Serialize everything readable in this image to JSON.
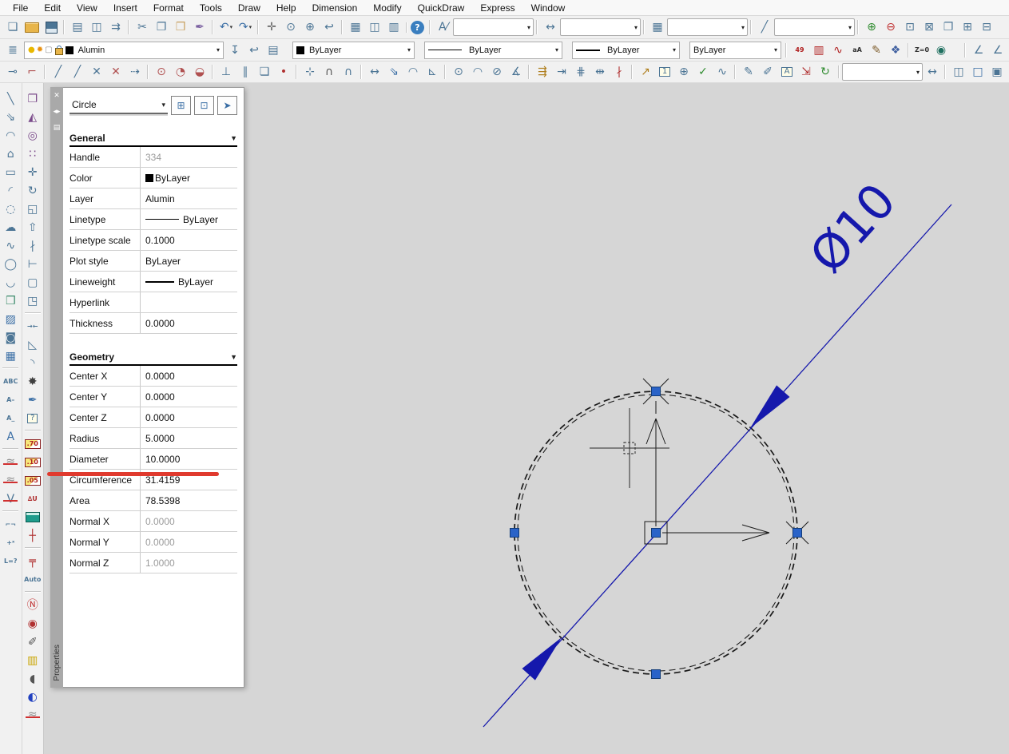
{
  "menu": {
    "items": [
      "File",
      "Edit",
      "View",
      "Insert",
      "Format",
      "Tools",
      "Draw",
      "Help",
      "Dimension",
      "Modify",
      "QuickDraw",
      "Express",
      "Window"
    ]
  },
  "toolbars": {
    "row1": [
      {
        "name": "new-file",
        "glyph": "❏",
        "color": "#4C7595"
      },
      {
        "name": "open-folder",
        "cls": "i-folder"
      },
      {
        "name": "save",
        "cls": "i-floppy"
      },
      {
        "name": "print",
        "glyph": "▤",
        "sep": true
      },
      {
        "name": "print-preview",
        "glyph": "◫"
      },
      {
        "name": "publish",
        "glyph": "⇉"
      },
      {
        "name": "cut",
        "glyph": "✂",
        "sep": true
      },
      {
        "name": "copy-clip",
        "glyph": "❐"
      },
      {
        "name": "paste",
        "glyph": "❒",
        "color": "#C8A060"
      },
      {
        "name": "format-painter",
        "glyph": "✒",
        "color": "#7A5FA0"
      },
      {
        "name": "undo",
        "glyph": "↶",
        "color": "#3A6EA5",
        "dd": true,
        "sep": true
      },
      {
        "name": "redo",
        "glyph": "↷",
        "color": "#3A6EA5",
        "dd": true
      },
      {
        "name": "pan",
        "glyph": "✛",
        "color": "#666666",
        "sep": true
      },
      {
        "name": "zoom-realtime",
        "glyph": "⊙"
      },
      {
        "name": "zoom-window-rt",
        "glyph": "⊕"
      },
      {
        "name": "zoom-previous",
        "glyph": "↩"
      },
      {
        "name": "properties-palette",
        "glyph": "▦",
        "sep": true
      },
      {
        "name": "designcenter",
        "glyph": "◫"
      },
      {
        "name": "tool-palettes",
        "glyph": "▥"
      },
      {
        "name": "help",
        "cls": "i-help",
        "glyph": "?",
        "sep": true
      },
      {
        "name": "text-style",
        "glyph": "A⁄",
        "sep": true
      },
      {
        "name": "text-style-dropdown",
        "cls": "dd"
      },
      {
        "name": "dim-style-icon",
        "glyph": "↔",
        "sep": true
      },
      {
        "name": "dim-style-dropdown",
        "cls": "dd"
      },
      {
        "name": "table-style-icon",
        "glyph": "▦",
        "sep": true
      },
      {
        "name": "table-style-dropdown",
        "cls": "dd"
      },
      {
        "name": "mleader-style-icon",
        "glyph": "╱",
        "sep": true
      },
      {
        "name": "mleader-style-dropdown",
        "cls": "dd"
      },
      {
        "name": "zoom-in",
        "glyph": "⊕",
        "color": "#2E8B2E",
        "sep": true
      },
      {
        "name": "zoom-out",
        "glyph": "⊖",
        "color": "#C03030"
      },
      {
        "name": "zoom-window",
        "glyph": "⊡"
      },
      {
        "name": "zoom-extents",
        "glyph": "⊠"
      },
      {
        "name": "zoom-page",
        "glyph": "❐"
      },
      {
        "name": "zoom-object",
        "glyph": "⊞"
      },
      {
        "name": "zoom-all",
        "glyph": "⊟"
      }
    ],
    "layer_combo": {
      "layer_name": "Alumin"
    },
    "row2_layer_tools": [
      {
        "name": "make-object-layer-current",
        "glyph": "↧"
      },
      {
        "name": "layer-previous",
        "glyph": "↩"
      },
      {
        "name": "layer-states",
        "glyph": "▤"
      }
    ],
    "color_combo": {
      "value": "ByLayer"
    },
    "linetype_combo": {
      "value": "ByLayer"
    },
    "lineweight_combo": {
      "value": "ByLayer"
    },
    "plotstyle_combo": {
      "value": "ByLayer"
    },
    "row2_express": [
      {
        "name": "dim-express-49",
        "glyph": "49",
        "cls": "txt",
        "color": "#B02020",
        "sep": true
      },
      {
        "name": "express-bars",
        "glyph": "▥",
        "color": "#B02020"
      },
      {
        "name": "express-curve",
        "glyph": "∿",
        "color": "#B02020"
      },
      {
        "name": "text-case",
        "glyph": "aA",
        "cls": "txt",
        "color": "#303030"
      },
      {
        "name": "express-edit",
        "glyph": "✎",
        "color": "#806030"
      },
      {
        "name": "express-palette",
        "glyph": "❖",
        "color": "#4060A0"
      },
      {
        "name": "z-zero",
        "glyph": "Z=0",
        "cls": "txt",
        "color": "#303030",
        "sep": true
      },
      {
        "name": "globe",
        "glyph": "◉",
        "color": "#207060"
      }
    ],
    "row2_right": [
      {
        "name": "ucs-angle-1",
        "glyph": "∠",
        "sep": true
      },
      {
        "name": "ucs-angle-2",
        "glyph": "∠"
      }
    ],
    "row3": [
      {
        "name": "snap-from",
        "glyph": "⊸"
      },
      {
        "name": "snap-endpoint",
        "glyph": "⌐",
        "color": "#B05050"
      },
      {
        "name": "line-tool",
        "glyph": "╱",
        "sep": true
      },
      {
        "name": "ray-tool",
        "glyph": "╱"
      },
      {
        "name": "snap-intersection",
        "glyph": "✕"
      },
      {
        "name": "snap-apparent-intersection",
        "glyph": "✕",
        "color": "#B05050"
      },
      {
        "name": "snap-extension",
        "glyph": "⇢"
      },
      {
        "name": "snap-center",
        "glyph": "⊙",
        "color": "#B05050",
        "sep": true
      },
      {
        "name": "snap-quadrant",
        "glyph": "◔",
        "color": "#B05050"
      },
      {
        "name": "snap-tangent",
        "glyph": "◒",
        "color": "#B05050"
      },
      {
        "name": "snap-perpendicular",
        "glyph": "⊥",
        "sep": true
      },
      {
        "name": "snap-parallel",
        "glyph": "∥"
      },
      {
        "name": "snap-insertion",
        "glyph": "❏"
      },
      {
        "name": "snap-node",
        "glyph": "•",
        "color": "#B03030"
      },
      {
        "name": "snap-nearest",
        "glyph": "⊹",
        "sep": true
      },
      {
        "name": "snap-none",
        "glyph": "∩",
        "color": "#555555"
      },
      {
        "name": "osnap-settings",
        "glyph": "∩"
      },
      {
        "name": "dim-linear",
        "glyph": "↔",
        "sep": true
      },
      {
        "name": "dim-aligned",
        "glyph": "⇘",
        "color": "#3A6EA5"
      },
      {
        "name": "dim-arc-length",
        "glyph": "◠"
      },
      {
        "name": "dim-ordinate",
        "glyph": "⊾"
      },
      {
        "name": "dim-radius",
        "glyph": "⊙",
        "sep": true
      },
      {
        "name": "dim-jogged",
        "glyph": "◠"
      },
      {
        "name": "dim-diameter",
        "glyph": "⊘"
      },
      {
        "name": "dim-angular",
        "glyph": "∡"
      },
      {
        "name": "quick-dimension",
        "glyph": "⇶",
        "color": "#B08020",
        "sep": true
      },
      {
        "name": "dim-continue",
        "glyph": "⇥"
      },
      {
        "name": "dim-baseline",
        "glyph": "⋕"
      },
      {
        "name": "dim-spacing",
        "glyph": "⇹"
      },
      {
        "name": "dim-break",
        "glyph": "∤",
        "color": "#B03030"
      },
      {
        "name": "multileader",
        "glyph": "↗",
        "color": "#B08020",
        "sep": true
      },
      {
        "name": "tolerance",
        "glyph": "1",
        "cls": "boxed"
      },
      {
        "name": "center-mark",
        "glyph": "⊕"
      },
      {
        "name": "dim-inspect",
        "glyph": "✓",
        "color": "#2E8B2E"
      },
      {
        "name": "dim-jog-line",
        "glyph": "∿"
      },
      {
        "name": "dim-edit",
        "glyph": "✎",
        "sep": true
      },
      {
        "name": "dim-text-edit",
        "glyph": "✐"
      },
      {
        "name": "dim-text-angle",
        "glyph": "A",
        "cls": "boxed"
      },
      {
        "name": "dim-oblique",
        "glyph": "⇲",
        "color": "#B03030"
      },
      {
        "name": "dim-update",
        "glyph": "↻",
        "color": "#2E8B2E"
      },
      {
        "name": "dimstyle-dropdown",
        "cls": "dd",
        "sep": true
      },
      {
        "name": "dimstyle-apply",
        "glyph": "↔"
      },
      {
        "name": "named-views",
        "glyph": "◫",
        "sep": true
      },
      {
        "name": "viewport-single",
        "glyph": "□",
        "color": "#3A6EA5"
      },
      {
        "name": "viewport-object",
        "glyph": "▣"
      }
    ],
    "left_draw": [
      {
        "name": "line",
        "glyph": "╲"
      },
      {
        "name": "construction-line",
        "glyph": "⇘"
      },
      {
        "name": "arc-3point",
        "glyph": "◠"
      },
      {
        "name": "polygon",
        "glyph": "⌂"
      },
      {
        "name": "rectangle",
        "glyph": "▭"
      },
      {
        "name": "arc-start-center",
        "glyph": "◜"
      },
      {
        "name": "circle",
        "glyph": "◌"
      },
      {
        "name": "revision-cloud",
        "glyph": "☁"
      },
      {
        "name": "spline",
        "glyph": "∿"
      },
      {
        "name": "ellipse",
        "glyph": "◯"
      },
      {
        "name": "arc-continue",
        "glyph": "◡"
      },
      {
        "name": "insert-block",
        "glyph": "❒",
        "color": "#3A8A6A"
      },
      {
        "name": "hatch",
        "glyph": "▨",
        "color": "#3A6EA5"
      },
      {
        "name": "donut",
        "glyph": "◙"
      },
      {
        "name": "table",
        "glyph": "▦",
        "color": "#3A6EA5"
      },
      {
        "name": "find-text",
        "glyph": "ABC",
        "cls": "txt",
        "sep": true
      },
      {
        "name": "single-line-text",
        "glyph": "A–",
        "cls": "txt"
      },
      {
        "name": "multiline-text",
        "glyph": "A_",
        "cls": "txt"
      },
      {
        "name": "stylized-text",
        "glyph": "A",
        "color": "#3A6EA5"
      },
      {
        "name": "superhatch",
        "glyph": "≋",
        "color": "#888888",
        "cls": "redline",
        "sep": true
      },
      {
        "name": "hatch-edit",
        "glyph": "≋",
        "color": "#888888",
        "cls": "redline"
      },
      {
        "name": "v-strike-tool",
        "glyph": "V",
        "cls": "redline"
      },
      {
        "name": "break-symbol",
        "glyph": "⌐¬",
        "cls": "txt",
        "sep": true
      },
      {
        "name": "point-x-tool",
        "glyph": "+ˣ",
        "cls": "txt"
      },
      {
        "name": "length-query",
        "glyph": "L=?",
        "cls": "txt"
      }
    ],
    "left_modify": [
      {
        "name": "copy",
        "glyph": "❐",
        "color": "#7A4A8A"
      },
      {
        "name": "mirror",
        "glyph": "◭",
        "color": "#7A4A8A"
      },
      {
        "name": "offset",
        "glyph": "◎",
        "color": "#7A4A8A"
      },
      {
        "name": "array",
        "glyph": "∷",
        "color": "#7A4A8A"
      },
      {
        "name": "move",
        "glyph": "✛"
      },
      {
        "name": "rotate",
        "glyph": "↻"
      },
      {
        "name": "scale",
        "glyph": "◱"
      },
      {
        "name": "stretch",
        "glyph": "⇧"
      },
      {
        "name": "trim",
        "glyph": "∤"
      },
      {
        "name": "extend",
        "glyph": "⊢"
      },
      {
        "name": "break-box",
        "glyph": "▢"
      },
      {
        "name": "break-at-point",
        "glyph": "◳"
      },
      {
        "name": "join",
        "glyph": "→←",
        "cls": "txt",
        "sep": true
      },
      {
        "name": "chamfer",
        "glyph": "◺"
      },
      {
        "name": "fillet",
        "glyph": "◝"
      },
      {
        "name": "explode",
        "glyph": "✸",
        "color": "#404040"
      },
      {
        "name": "match-properties",
        "glyph": "✒",
        "color": "#3A6EA5"
      },
      {
        "name": "help-docs",
        "glyph": "?",
        "cls": "boxed"
      },
      {
        "name": "precision-70",
        "glyph": ".70",
        "cls": "prec",
        "sep": true
      },
      {
        "name": "precision-10",
        "glyph": ".10",
        "cls": "prec"
      },
      {
        "name": "precision-05",
        "glyph": ".05",
        "cls": "prec"
      },
      {
        "name": "delta-update",
        "glyph": "∆U",
        "cls": "txt",
        "color": "#B03030"
      },
      {
        "name": "calculator",
        "cls": "i-calc"
      },
      {
        "name": "divider-tool",
        "glyph": "┼",
        "color": "#B03030"
      },
      {
        "name": "breakline",
        "glyph": "╤",
        "color": "#B03030",
        "sep": true
      },
      {
        "name": "auto-tool",
        "glyph": "Auto",
        "cls": "txt"
      },
      {
        "name": "north-symbol",
        "glyph": "Ⓝ",
        "color": "#C03030",
        "sep": true
      },
      {
        "name": "point-marker",
        "glyph": "◉",
        "color": "#B03030"
      },
      {
        "name": "pin-tool",
        "glyph": "✐",
        "color": "#555555"
      },
      {
        "name": "yellow-grate",
        "glyph": "▥",
        "color": "#C8A400"
      },
      {
        "name": "protractor",
        "glyph": "◖",
        "color": "#555555"
      },
      {
        "name": "m-compass",
        "glyph": "◐",
        "color": "#2040C0"
      },
      {
        "name": "hatch-red",
        "glyph": "≋",
        "color": "#888888",
        "cls": "redline"
      }
    ]
  },
  "palette": {
    "title": "Properties",
    "object_type": "Circle",
    "strip_icons": [
      {
        "name": "close-palette",
        "glyph": "✕"
      },
      {
        "name": "autohide-palette",
        "glyph": "◂▸"
      },
      {
        "name": "palette-menu",
        "glyph": "▤"
      }
    ],
    "header_buttons": [
      {
        "name": "toggle-pickadd",
        "glyph": "⊞"
      },
      {
        "name": "select-objects",
        "glyph": "⊡"
      },
      {
        "name": "quick-select",
        "glyph": "➤"
      }
    ],
    "sections": [
      {
        "title": "General",
        "rows": [
          {
            "label": "Handle",
            "value": "334",
            "gray": true
          },
          {
            "label": "Color",
            "value": "ByLayer",
            "swatch": true
          },
          {
            "label": "Layer",
            "value": "Alumin"
          },
          {
            "label": "Linetype",
            "value": "ByLayer",
            "line": "thin"
          },
          {
            "label": "Linetype scale",
            "value": "0.1000"
          },
          {
            "label": "Plot style",
            "value": "ByLayer"
          },
          {
            "label": "Lineweight",
            "value": "ByLayer",
            "line": "thick"
          },
          {
            "label": "Hyperlink",
            "value": ""
          },
          {
            "label": "Thickness",
            "value": "0.0000"
          }
        ]
      },
      {
        "title": "Geometry",
        "rows": [
          {
            "label": "Center X",
            "value": "0.0000"
          },
          {
            "label": "Center Y",
            "value": "0.0000"
          },
          {
            "label": "Center Z",
            "value": "0.0000"
          },
          {
            "label": "Radius",
            "value": "5.0000"
          },
          {
            "label": "Diameter",
            "value": "10.0000"
          },
          {
            "label": "Circumference",
            "value": "31.4159"
          },
          {
            "label": "Area",
            "value": "78.5398"
          },
          {
            "label": "Normal X",
            "value": "0.0000",
            "gray": true
          },
          {
            "label": "Normal Y",
            "value": "0.0000",
            "gray": true
          },
          {
            "label": "Normal Z",
            "value": "1.0000",
            "gray": true
          }
        ]
      }
    ],
    "annotation_color": "#E03A2E"
  },
  "canvas": {
    "dimension_label": "Ø10",
    "dimension_color": "#1518AC",
    "grip_color": "#2A63C8"
  }
}
